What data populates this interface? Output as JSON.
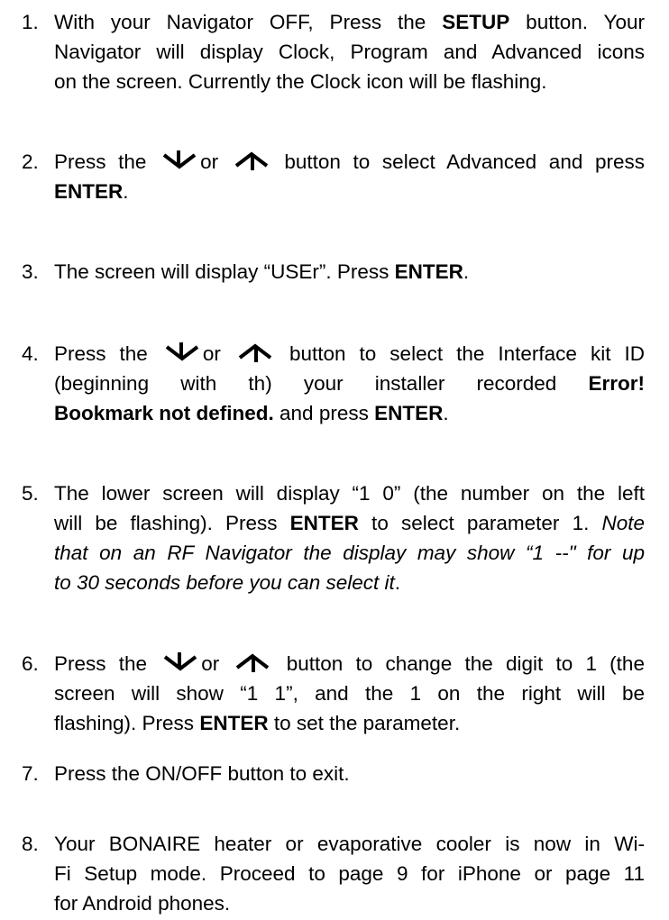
{
  "steps": [
    {
      "num": "1.",
      "lines": [
        [
          "With your Navigator OFF, Press the ",
          "SETUP",
          " button.  Your"
        ],
        "Navigator will display Clock, Program and Advanced icons",
        "on the screen. Currently the Clock icon will be flashing."
      ]
    },
    {
      "num": "2.",
      "a": "Press the",
      "or": "or",
      "b": "button to select Advanced and press",
      "enter": "ENTER",
      "end": "."
    },
    {
      "num": "3.",
      "a": "The screen will display “USEr”.  Press ",
      "enter": "ENTER",
      "end": "."
    },
    {
      "num": "4.",
      "a": "Press the",
      "or": "or",
      "b": "button to select the Interface kit ID",
      "c": "(beginning   with   th)   your   installer   recorded",
      "err1": "Error!",
      "err2": "Bookmark not defined.",
      "d": " and press ",
      "enter": "ENTER",
      "end": "."
    },
    {
      "num": "5.",
      "l1": "The lower screen will display “1 0” (the number on the left",
      "l2a": "will be flashing).  Press ",
      "enter": "ENTER",
      "l2b": " to select parameter 1.  ",
      "note1": "Note",
      "note2": "that on an RF Navigator the display may show “1 --\" for up",
      "note3": "to 30 seconds before you can select it",
      "end": "."
    },
    {
      "num": "6.",
      "a": "Press the",
      "or": "or",
      "b": "button to change the digit to 1 (the",
      "l2": "screen will show “1 1”, and the 1 on the right will be",
      "l3a": "flashing).  Press ",
      "enter": "ENTER",
      "l3b": " to set the parameter."
    },
    {
      "num": "7.",
      "a": "Press the ON/OFF button to exit."
    },
    {
      "num": "8.",
      "l1": "Your BONAIRE heater or evaporative cooler is now in Wi-",
      "l2": "Fi Setup mode.  Proceed to page 9 for iPhone or page 11",
      "l3": "for Android phones."
    }
  ],
  "icons": {
    "down": "down-arrow-icon",
    "up": "up-arrow-icon"
  }
}
